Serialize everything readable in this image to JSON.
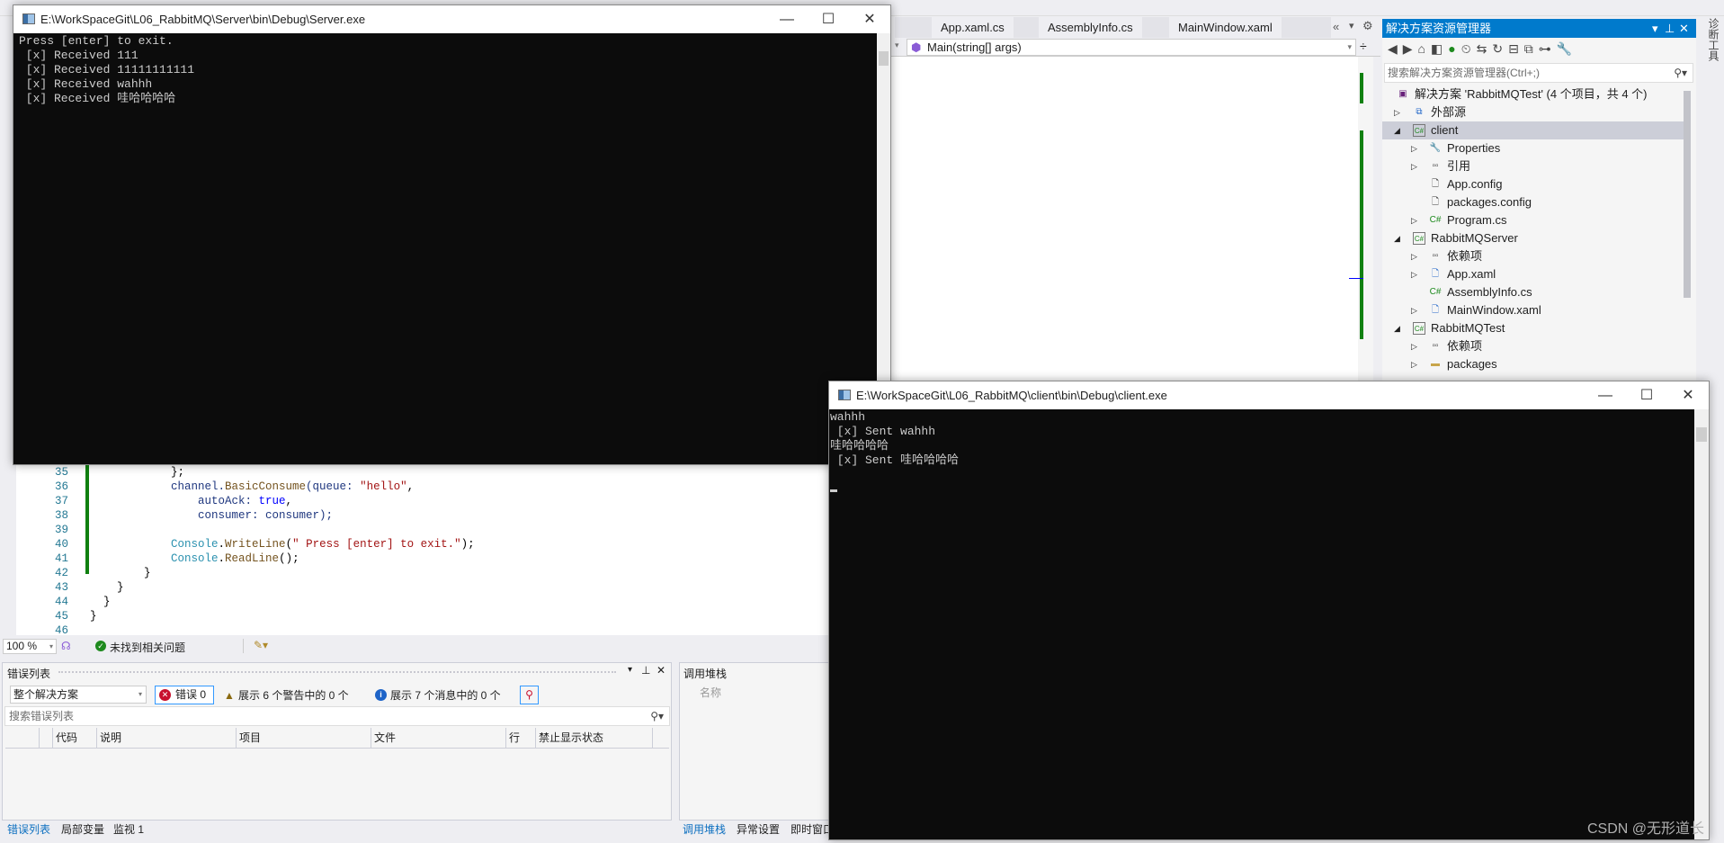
{
  "ide": {
    "doc_tabs": [
      "App.xaml.cs",
      "AssemblyInfo.cs",
      "MainWindow.xaml"
    ],
    "tab_overflow_icons": [
      "chevrons-left-icon",
      "dropdown-icon",
      "gear-icon"
    ],
    "nav_member": "Main(string[] args)",
    "code_lines": [
      {
        "n": "35",
        "parts": [
          {
            "t": "            };",
            "c": "#000000"
          }
        ]
      },
      {
        "n": "36",
        "parts": [
          {
            "t": "            channel.",
            "c": "#1f377f"
          },
          {
            "t": "BasicConsume",
            "c": "#74531f"
          },
          {
            "t": "(queue: ",
            "c": "#1f377f"
          },
          {
            "t": "\"hello\"",
            "c": "#a31515"
          },
          {
            "t": ",",
            "c": "#000000"
          }
        ]
      },
      {
        "n": "37",
        "parts": [
          {
            "t": "                autoAck: ",
            "c": "#1f377f"
          },
          {
            "t": "true",
            "c": "#0000ff"
          },
          {
            "t": ",",
            "c": "#000000"
          }
        ]
      },
      {
        "n": "38",
        "parts": [
          {
            "t": "                consumer: consumer);",
            "c": "#1f377f"
          }
        ]
      },
      {
        "n": "39",
        "parts": []
      },
      {
        "n": "40",
        "parts": [
          {
            "t": "            Console",
            "c": "#2b91af"
          },
          {
            "t": ".",
            "c": "#000000"
          },
          {
            "t": "WriteLine",
            "c": "#74531f"
          },
          {
            "t": "(",
            "c": "#000000"
          },
          {
            "t": "\" Press [enter] to exit.\"",
            "c": "#a31515"
          },
          {
            "t": ");",
            "c": "#000000"
          }
        ]
      },
      {
        "n": "41",
        "parts": [
          {
            "t": "            Console",
            "c": "#2b91af"
          },
          {
            "t": ".",
            "c": "#000000"
          },
          {
            "t": "ReadLine",
            "c": "#74531f"
          },
          {
            "t": "();",
            "c": "#000000"
          }
        ]
      },
      {
        "n": "42",
        "parts": [
          {
            "t": "        }",
            "c": "#000000"
          }
        ]
      },
      {
        "n": "43",
        "parts": [
          {
            "t": "    }",
            "c": "#000000"
          }
        ]
      },
      {
        "n": "44",
        "parts": [
          {
            "t": "  }",
            "c": "#000000"
          }
        ]
      },
      {
        "n": "45",
        "parts": [
          {
            "t": "}",
            "c": "#000000"
          }
        ]
      },
      {
        "n": "46",
        "parts": []
      }
    ],
    "status": {
      "zoom": "100 %",
      "issues": "未找到相关问题"
    },
    "error_list": {
      "title": "错误列表",
      "scope": "整个解决方案",
      "errors": "错误 0",
      "warnings": "展示 6 个警告中的 0 个",
      "messages": "展示 7 个消息中的 0 个",
      "search_placeholder": "搜索错误列表",
      "columns": [
        "",
        "",
        "代码",
        "说明",
        "项目",
        "文件",
        "行",
        "禁止显示状态"
      ],
      "bottom_tabs": [
        "错误列表",
        "局部变量",
        "监视 1"
      ]
    },
    "call_stack": {
      "title": "调用堆栈",
      "column": "名称",
      "bottom_tabs": [
        "调用堆栈",
        "异常设置",
        "即时窗口"
      ]
    },
    "solution_explorer": {
      "title": "解决方案资源管理器",
      "search_placeholder": "搜索解决方案资源管理器(Ctrl+;)",
      "items": [
        {
          "label": "解决方案 'RabbitMQTest' (4 个项目，共 4 个)",
          "level": 0,
          "expander": "",
          "icon": "solution-icon"
        },
        {
          "label": "外部源",
          "level": 1,
          "expander": "collapsed",
          "icon": "external-sources-icon"
        },
        {
          "label": "client",
          "level": 1,
          "expander": "expanded",
          "icon": "csharp-project-icon",
          "selected": true
        },
        {
          "label": "Properties",
          "level": 2,
          "expander": "collapsed",
          "icon": "wrench-icon"
        },
        {
          "label": "引用",
          "level": 2,
          "expander": "collapsed",
          "icon": "references-icon"
        },
        {
          "label": "App.config",
          "level": 2,
          "expander": "",
          "icon": "config-file-icon"
        },
        {
          "label": "packages.config",
          "level": 2,
          "expander": "",
          "icon": "config-file-icon"
        },
        {
          "label": "Program.cs",
          "level": 2,
          "expander": "collapsed",
          "icon": "csharp-file-icon"
        },
        {
          "label": "RabbitMQServer",
          "level": 1,
          "expander": "expanded",
          "icon": "csharp-project-icon"
        },
        {
          "label": "依赖项",
          "level": 2,
          "expander": "collapsed",
          "icon": "references-icon"
        },
        {
          "label": "App.xaml",
          "level": 2,
          "expander": "collapsed",
          "icon": "xaml-file-icon"
        },
        {
          "label": "AssemblyInfo.cs",
          "level": 2,
          "expander": "",
          "icon": "csharp-file-icon"
        },
        {
          "label": "MainWindow.xaml",
          "level": 2,
          "expander": "collapsed",
          "icon": "xaml-file-icon"
        },
        {
          "label": "RabbitMQTest",
          "level": 1,
          "expander": "expanded",
          "icon": "csharp-project-icon"
        },
        {
          "label": "依赖项",
          "level": 2,
          "expander": "collapsed",
          "icon": "references-icon"
        },
        {
          "label": "packages",
          "level": 2,
          "expander": "collapsed",
          "icon": "folder-icon"
        }
      ]
    },
    "side_tab": "诊断工具"
  },
  "server_window": {
    "title": "E:\\WorkSpaceGit\\L06_RabbitMQ\\Server\\bin\\Debug\\Server.exe",
    "lines": [
      "Press [enter] to exit.",
      " [x] Received 111",
      " [x] Received 11111111111",
      " [x] Received wahhh",
      " [x] Received 哇哈哈哈哈"
    ]
  },
  "client_window": {
    "title": "E:\\WorkSpaceGit\\L06_RabbitMQ\\client\\bin\\Debug\\client.exe",
    "lines": [
      "wahhh",
      " [x] Sent wahhh",
      "哇哈哈哈哈",
      " [x] Sent 哇哈哈哈哈"
    ]
  },
  "watermark": "CSDN @无形道长",
  "colors": {
    "accent": "#007acc",
    "console_bg": "#0c0c0c",
    "console_fg": "#cccccc",
    "change_bar": "#108010"
  }
}
